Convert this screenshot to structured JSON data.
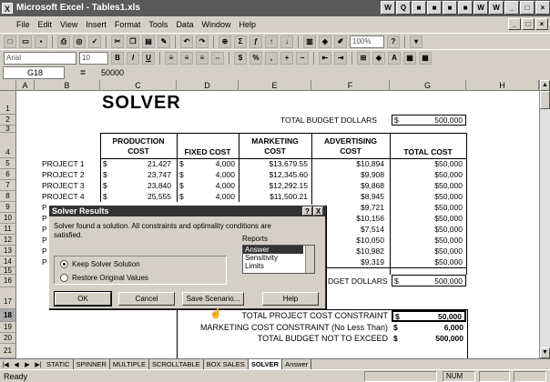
{
  "window": {
    "title": "Microsoft Excel - Tables1.xls",
    "title_icons": [
      "W",
      "Q",
      "■",
      "■",
      "■",
      "■",
      "■",
      "W",
      "W"
    ],
    "mdi_controls": [
      "_",
      "□",
      "×"
    ],
    "doc_controls": [
      "_",
      "□",
      "×"
    ]
  },
  "menu": [
    "File",
    "Edit",
    "View",
    "Insert",
    "Format",
    "Tools",
    "Data",
    "Window",
    "Help"
  ],
  "toolbar": {
    "zoom": "100%",
    "font_name": "Arial",
    "font_size": "10"
  },
  "formula_bar": {
    "cell_ref": "G18",
    "equals": "=",
    "value": "50000"
  },
  "columns": [
    "A",
    "B",
    "C",
    "D",
    "E",
    "F",
    "G",
    "H"
  ],
  "rows": [
    "1",
    "2",
    "3",
    "4",
    "5",
    "6",
    "7",
    "8",
    "9",
    "10",
    "11",
    "12",
    "13",
    "14",
    "15",
    "16",
    "17",
    "18",
    "19",
    "20",
    "21"
  ],
  "sheet": {
    "title": "SOLVER",
    "total_budget_label": "TOTAL BUDGET DOLLARS",
    "total_budget_currency": "$",
    "total_budget_value": "500,000",
    "headers": {
      "production": "PRODUCTION COST",
      "fixed": "FIXED COST",
      "marketing": "MARKETING COST",
      "advertising": "ADVERTISING COST",
      "total": "TOTAL COST"
    },
    "projects": [
      {
        "name": "PROJECT 1",
        "cur": "$",
        "prod": "21,427",
        "fcur": "$",
        "fixed": "4,000",
        "mkt": "$13,679.55",
        "adv": "$10,894",
        "total": "$50,000"
      },
      {
        "name": "PROJECT 2",
        "cur": "$",
        "prod": "23,747",
        "fcur": "$",
        "fixed": "4,000",
        "mkt": "$12,345.60",
        "adv": "$9,908",
        "total": "$50,000"
      },
      {
        "name": "PROJECT 3",
        "cur": "$",
        "prod": "23,840",
        "fcur": "$",
        "fixed": "4,000",
        "mkt": "$12,292.15",
        "adv": "$9,868",
        "total": "$50,000"
      },
      {
        "name": "PROJECT 4",
        "cur": "$",
        "prod": "25,555",
        "fcur": "$",
        "fixed": "4,000",
        "mkt": "$11,500.21",
        "adv": "$8,945",
        "total": "$50,000"
      },
      {
        "name": "P",
        "adv": "$9,721",
        "total": "$50,000"
      },
      {
        "name": "P",
        "adv": "$10,156",
        "total": "$50,000"
      },
      {
        "name": "P",
        "adv": "$7,514",
        "total": "$50,000"
      },
      {
        "name": "P",
        "adv": "$10,050",
        "total": "$50,000"
      },
      {
        "name": "P",
        "adv": "$10,982",
        "total": "$50,000"
      },
      {
        "name": "P",
        "adv": "$9,319",
        "total": "$50,000"
      }
    ],
    "row16_label": "DGET DOLLARS",
    "row16_cur": "$",
    "row16_value": "500,000",
    "constraints": [
      {
        "label": "TOTAL PROJECT COST CONSTRAINT",
        "cur": "$",
        "value": "50,000"
      },
      {
        "label": "MARKETING COST CONSTRAINT (No Less Than)",
        "cur": "$",
        "value": "6,000"
      },
      {
        "label": "TOTAL BUDGET NOT TO EXCEED",
        "cur": "$",
        "value": "500,000"
      }
    ]
  },
  "dialog": {
    "title": "Solver Results",
    "title_buttons": [
      "?",
      "X"
    ],
    "message": "Solver found a solution.  All constraints and optimality conditions are satisfied.",
    "keep_label": "Keep Solver Solution",
    "restore_label": "Restore Original Values",
    "reports_label": "Reports",
    "reports": [
      "Answer",
      "Sensitivity",
      "Limits"
    ],
    "ok": "OK",
    "cancel": "Cancel",
    "save": "Save Scenario...",
    "help": "Help"
  },
  "tabs": [
    "STATIC",
    "SPINNER",
    "MULTIPLE",
    "SCROLLTABLE",
    "BOX SALES",
    "SOLVER",
    "Answer"
  ],
  "tab_nav": [
    "|◀",
    "◀",
    "▶",
    "▶|"
  ],
  "status": {
    "text": "Ready",
    "num": "NUM"
  }
}
